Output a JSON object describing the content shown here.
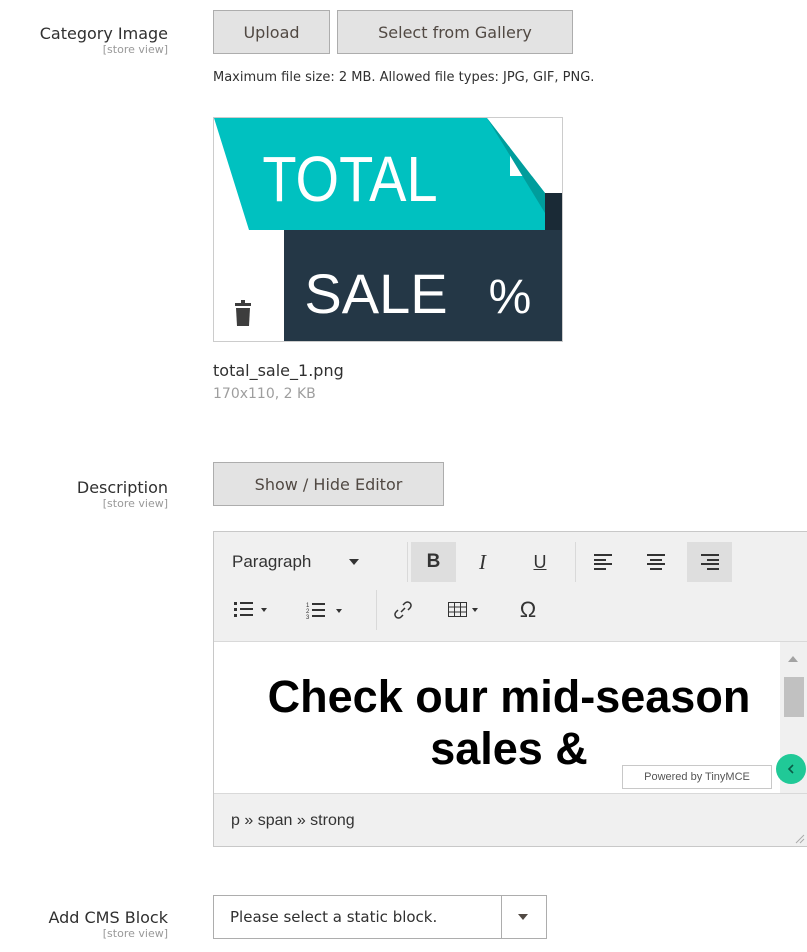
{
  "category_image": {
    "label": "Category Image",
    "scope": "[store view]",
    "upload_label": "Upload",
    "gallery_label": "Select from Gallery",
    "note": "Maximum file size: 2 MB. Allowed file types: JPG, GIF, PNG.",
    "preview": {
      "line1": "TOTAL",
      "line2": "SALE",
      "line3": "%"
    },
    "file_name": "total_sale_1.png",
    "file_meta": "170x110, 2 KB"
  },
  "description": {
    "label": "Description",
    "scope": "[store view]",
    "toggle_label": "Show / Hide Editor",
    "editor": {
      "format_select": "Paragraph",
      "bold": "B",
      "italic": "I",
      "underline": "U",
      "special_char": "Ω",
      "content": "Check our mid-season sales &",
      "branding": "Powered by TinyMCE",
      "path": "p » span » strong"
    }
  },
  "cms_block": {
    "label": "Add CMS Block",
    "scope": "[store view]",
    "placeholder": "Please select a static block."
  },
  "colors": {
    "teal": "#00c1c0",
    "navy": "#243746",
    "button_bg": "#e3e3e3",
    "tinymce_green": "#20c997"
  }
}
